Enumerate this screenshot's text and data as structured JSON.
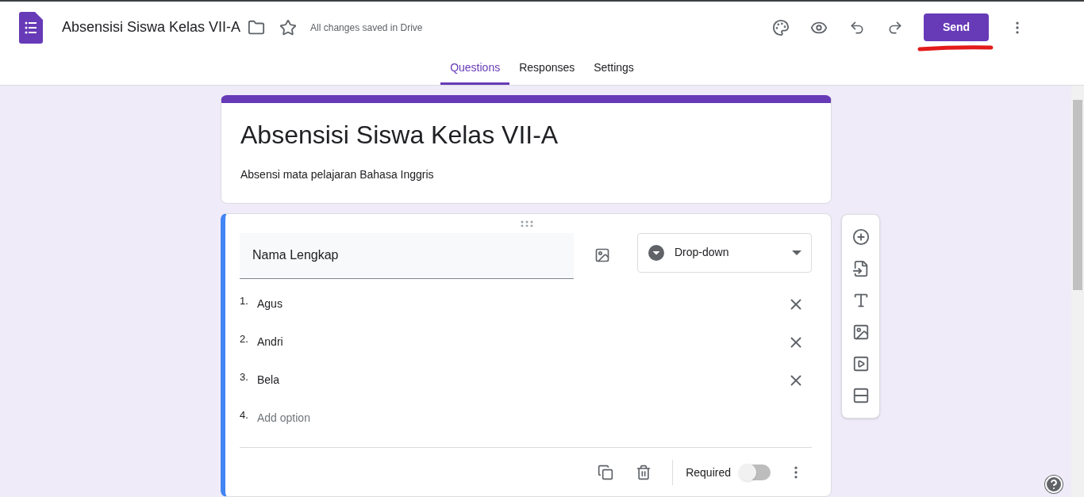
{
  "header": {
    "title": "Absensisi Siswa Kelas VII-A",
    "save_status": "All changes saved in Drive",
    "send_button": "Send"
  },
  "tabs": [
    {
      "label": "Questions",
      "selected": true
    },
    {
      "label": "Responses",
      "selected": false
    },
    {
      "label": "Settings",
      "selected": false
    }
  ],
  "form": {
    "title": "Absensisi Siswa Kelas VII-A",
    "description": "Absensi mata pelajaran Bahasa Inggris"
  },
  "question": {
    "title": "Nama Lengkap",
    "type": "Drop-down",
    "required": {
      "label": "Required",
      "on": false
    },
    "options": [
      {
        "kind": "option",
        "number": "1.",
        "label": "Agus"
      },
      {
        "kind": "option",
        "number": "2.",
        "label": "Andri"
      },
      {
        "kind": "option",
        "number": "3.",
        "label": "Bela"
      },
      {
        "kind": "add",
        "number": "4.",
        "label": "Add option"
      }
    ]
  }
}
